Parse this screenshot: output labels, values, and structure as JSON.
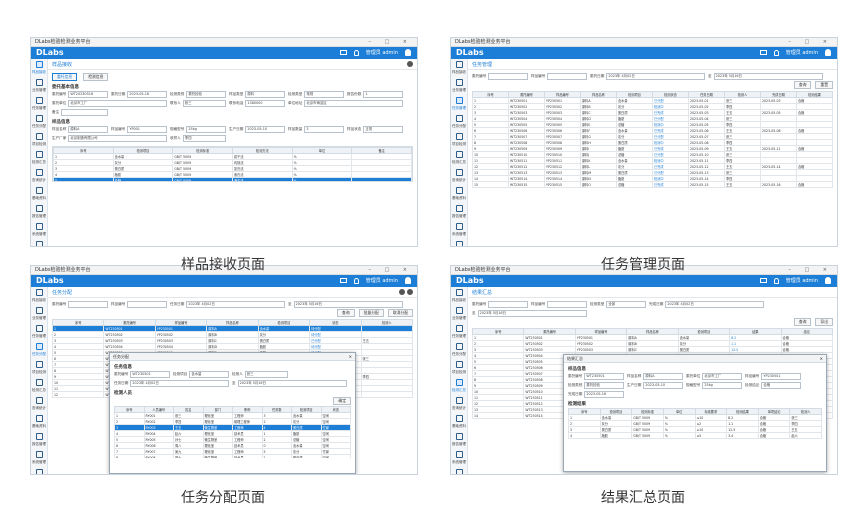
{
  "app": {
    "logo": "DLabs",
    "window_title": "DLabs检验检测业务平台",
    "user": "管理员 admin",
    "window_controls": "– □ ×"
  },
  "sidebar": [
    {
      "label": "样品接收"
    },
    {
      "label": "业务管理"
    },
    {
      "label": "任务管理"
    },
    {
      "label": "任务分配"
    },
    {
      "label": "项目检测"
    },
    {
      "label": "检测汇总"
    },
    {
      "label": "查询统计"
    },
    {
      "label": "基础资料"
    },
    {
      "label": "报告管理"
    },
    {
      "label": "系统管理"
    },
    {
      "label": "系统设置"
    }
  ],
  "captions": {
    "p1": "样品接收页面",
    "p2": "任务管理页面",
    "p3": "任务分配页面",
    "p4": "结果汇总页面"
  },
  "p1": {
    "title": "样品接收",
    "tabs": [
      "委托信息",
      "检测信息"
    ],
    "section1": "委托基本信息",
    "fields1": [
      {
        "label": "委托编号",
        "value": "WT20230516"
      },
      {
        "label": "委托日期",
        "value": "2023-05-16"
      },
      {
        "label": "检测类别",
        "value": "委托检验"
      },
      {
        "label": "样品类型",
        "value": "原料"
      },
      {
        "label": "检测类型",
        "value": "常规"
      },
      {
        "label": "报告份数",
        "value": "1"
      },
      {
        "label": "委托单位",
        "value": "北京市工厂"
      },
      {
        "label": "联系人",
        "value": "张三"
      },
      {
        "label": "联系电话",
        "value": "1380000"
      },
      {
        "label": "单位地址",
        "value": "北京市海淀区"
      },
      {
        "label": "备注",
        "value": ""
      }
    ],
    "section2": "样品信息",
    "fields2": [
      {
        "label": "样品名称",
        "value": "原料A"
      },
      {
        "label": "样品编号",
        "value": "YP001"
      },
      {
        "label": "规格型号",
        "value": "25kg"
      },
      {
        "label": "生产日期",
        "value": "2023-05-10"
      },
      {
        "label": "样品数量",
        "value": "3"
      },
      {
        "label": "样品状态",
        "value": "正常"
      },
      {
        "label": "生产厂家",
        "value": "北京制造有限公司"
      },
      {
        "label": "收样人",
        "value": "李四"
      }
    ],
    "table_headers": [
      "序号",
      "检测项目",
      "检测标准",
      "检测方法",
      "单位",
      "备注"
    ],
    "table_rows": [
      [
        "1",
        "含水量",
        "GB/T 5009",
        "烘干法",
        "%",
        ""
      ],
      [
        "2",
        "灰分",
        "GB/T 5009",
        "灼烧法",
        "%",
        ""
      ],
      [
        "3",
        "蛋白质",
        "GB/T 5009",
        "凯氏法",
        "%",
        ""
      ],
      [
        "4",
        "脂肪",
        "GB/T 5009",
        "索氏法",
        "%",
        ""
      ],
      [
        "5",
        "总糖",
        "GB/T 5009",
        "滴定法",
        "%",
        ""
      ]
    ]
  },
  "p2": {
    "title": "任务管理",
    "filters": [
      {
        "label": "委托编号",
        "value": ""
      },
      {
        "label": "样品编号",
        "value": ""
      },
      {
        "label": "委托日期",
        "value": "2023年 4月02日"
      },
      {
        "label": "至",
        "value": "2023年 5月16日"
      }
    ],
    "buttons": [
      "查询",
      "重置"
    ],
    "table_headers": [
      "序号",
      "委托编号",
      "样品编号",
      "样品名称",
      "检测项目",
      "检测状态",
      "任务日期",
      "检测人",
      "完成日期",
      "检测结果"
    ],
    "table_rows": [
      [
        "1",
        "WT230501",
        "YP230501",
        "原料A",
        "含水量",
        "已分配",
        "2023-05-01",
        "张三",
        "2023-05-03",
        "合格"
      ],
      [
        "2",
        "WT230502",
        "YP230502",
        "原料B",
        "灰分",
        "检测中",
        "2023-05-02",
        "李四",
        "",
        ""
      ],
      [
        "3",
        "WT230503",
        "YP230503",
        "原料C",
        "蛋白质",
        "已完成",
        "2023-05-03",
        "王五",
        "2023-05-05",
        "合格"
      ],
      [
        "4",
        "WT230504",
        "YP230504",
        "原料D",
        "脂肪",
        "已分配",
        "2023-05-04",
        "张三",
        "",
        ""
      ],
      [
        "5",
        "WT230505",
        "YP230505",
        "原料E",
        "总糖",
        "检测中",
        "2023-05-05",
        "李四",
        "",
        ""
      ],
      [
        "6",
        "WT230506",
        "YP230506",
        "原料F",
        "含水量",
        "已完成",
        "2023-05-06",
        "王五",
        "2023-05-08",
        "合格"
      ],
      [
        "7",
        "WT230507",
        "YP230507",
        "原料G",
        "灰分",
        "已分配",
        "2023-05-07",
        "张三",
        "",
        ""
      ],
      [
        "8",
        "WT230508",
        "YP230508",
        "原料H",
        "蛋白质",
        "检测中",
        "2023-05-08",
        "李四",
        "",
        ""
      ],
      [
        "9",
        "WT230509",
        "YP230509",
        "原料I",
        "脂肪",
        "已完成",
        "2023-05-09",
        "王五",
        "2023-05-11",
        "合格"
      ],
      [
        "10",
        "WT230510",
        "YP230510",
        "原料J",
        "总糖",
        "已分配",
        "2023-05-10",
        "张三",
        "",
        ""
      ],
      [
        "11",
        "WT230511",
        "YP230511",
        "原料K",
        "含水量",
        "检测中",
        "2023-05-11",
        "李四",
        "",
        ""
      ],
      [
        "12",
        "WT230512",
        "YP230512",
        "原料L",
        "灰分",
        "已完成",
        "2023-05-12",
        "王五",
        "2023-05-14",
        "合格"
      ],
      [
        "13",
        "WT230513",
        "YP230513",
        "原料M",
        "蛋白质",
        "已分配",
        "2023-05-13",
        "张三",
        "",
        ""
      ],
      [
        "14",
        "WT230514",
        "YP230514",
        "原料N",
        "脂肪",
        "检测中",
        "2023-05-14",
        "李四",
        "",
        ""
      ],
      [
        "15",
        "WT230515",
        "YP230515",
        "原料O",
        "总糖",
        "已完成",
        "2023-05-15",
        "王五",
        "2023-05-16",
        "合格"
      ]
    ]
  },
  "p3": {
    "title": "任务分配",
    "filters": [
      {
        "label": "委托编号",
        "value": ""
      },
      {
        "label": "样品编号",
        "value": ""
      },
      {
        "label": "任务日期",
        "value": "2023年 4月02日"
      },
      {
        "label": "至",
        "value": "2023年 5月16日"
      }
    ],
    "buttons": [
      "查询",
      "批量分配",
      "取消分配"
    ],
    "table_headers": [
      "序号",
      "委托编号",
      "样品编号",
      "样品名称",
      "检测项目",
      "状态",
      "检测人"
    ],
    "table_rows": [
      [
        "1",
        "WT230501",
        "YP230501",
        "原料A",
        "含水量",
        "待分配",
        ""
      ],
      [
        "2",
        "WT230502",
        "YP230502",
        "原料B",
        "灰分",
        "待分配",
        ""
      ],
      [
        "3",
        "WT230503",
        "YP230503",
        "原料C",
        "蛋白质",
        "已分配",
        "王五"
      ],
      [
        "4",
        "WT230504",
        "YP230504",
        "原料D",
        "脂肪",
        "待分配",
        ""
      ],
      [
        "5",
        "WT230505",
        "YP230505",
        "原料E",
        "总糖",
        "待分配",
        ""
      ],
      [
        "6",
        "WT230506",
        "YP230506",
        "原料F",
        "含水量",
        "已分配",
        "张三"
      ],
      [
        "7",
        "WT230507",
        "YP230507",
        "原料G",
        "灰分",
        "待分配",
        ""
      ],
      [
        "8",
        "WT230508",
        "YP230508",
        "原料H",
        "蛋白质",
        "待分配",
        ""
      ],
      [
        "9",
        "WT230509",
        "YP230509",
        "原料I",
        "脂肪",
        "已分配",
        "李四"
      ],
      [
        "10",
        "WT230510",
        "YP230510",
        "原料J",
        "总糖",
        "待分配",
        ""
      ],
      [
        "11",
        "WT230511",
        "YP230511",
        "原料K",
        "含水量",
        "待分配",
        ""
      ],
      [
        "12",
        "WT230512",
        "YP230512",
        "原料L",
        "灰分",
        "待分配",
        ""
      ]
    ],
    "modal": {
      "title": "任务分配",
      "section1": "任务信息",
      "fields": [
        {
          "label": "委托编号",
          "value": "WT230501"
        },
        {
          "label": "检测项目",
          "value": "含水量"
        },
        {
          "label": "检测人",
          "value": "张三"
        },
        {
          "label": "任务日期",
          "value": "2023年 4月02日"
        },
        {
          "label": "至",
          "value": "2023年 5月16日"
        }
      ],
      "section2": "检测人员",
      "confirm": "确定",
      "table_headers": [
        "序号",
        "人员编号",
        "姓名",
        "部门",
        "职称",
        "任务数",
        "检测项目",
        "状态"
      ],
      "table_rows": [
        [
          "1",
          "RY001",
          "张三",
          "理化室",
          "工程师",
          "3",
          "含水量",
          "空闲"
        ],
        [
          "2",
          "RY002",
          "李四",
          "理化室",
          "助理工程师",
          "2",
          "灰分",
          "空闲"
        ],
        [
          "3",
          "RY003",
          "王五",
          "微生物室",
          "工程师",
          "4",
          "蛋白质",
          "忙碌"
        ],
        [
          "4",
          "RY004",
          "赵六",
          "理化室",
          "技术员",
          "1",
          "脂肪",
          "空闲"
        ],
        [
          "5",
          "RY005",
          "孙七",
          "微生物室",
          "工程师",
          "2",
          "总糖",
          "空闲"
        ],
        [
          "6",
          "RY006",
          "周八",
          "理化室",
          "技术员",
          "0",
          "含水量",
          "空闲"
        ],
        [
          "7",
          "RY007",
          "吴九",
          "理化室",
          "工程师",
          "5",
          "灰分",
          "忙碌"
        ],
        [
          "8",
          "RY008",
          "郑十",
          "微生物室",
          "技术员",
          "1",
          "蛋白质",
          "空闲"
        ]
      ]
    }
  },
  "p4": {
    "title": "结果汇总",
    "filters": [
      {
        "label": "委托编号",
        "value": ""
      },
      {
        "label": "样品编号",
        "value": ""
      },
      {
        "label": "检测类型",
        "value": "全部"
      },
      {
        "label": "完成日期",
        "value": "2023年 4月02日"
      },
      {
        "label": "至",
        "value": "2023年 5月16日"
      }
    ],
    "buttons": [
      "查询",
      "导出"
    ],
    "table_headers": [
      "序号",
      "委托编号",
      "样品编号",
      "样品名称",
      "检测项目",
      "结果",
      "结论"
    ],
    "table_rows": [
      [
        "1",
        "WT230501",
        "YP230501",
        "原料A",
        "含水量",
        "8.2",
        "合格"
      ],
      [
        "2",
        "WT230502",
        "YP230502",
        "原料B",
        "灰分",
        "1.1",
        "合格"
      ],
      [
        "3",
        "WT230503",
        "YP230503",
        "原料C",
        "蛋白质",
        "12.5",
        "合格"
      ],
      [
        "4",
        "WT230504",
        "YP230504",
        "原料D",
        "脂肪",
        "3.4",
        "合格"
      ],
      [
        "5",
        "WT230505",
        "YP230505",
        "原料E",
        "总糖",
        "5.6",
        "合格"
      ],
      [
        "6",
        "WT230506",
        "YP230506",
        "原料F",
        "含水量",
        "9.1",
        "合格"
      ],
      [
        "7",
        "WT230507",
        "YP230507",
        "原料G",
        "灰分",
        "1.3",
        "合格"
      ],
      [
        "8",
        "WT230508",
        "YP230508",
        "原料H",
        "蛋白质",
        "11.8",
        "合格"
      ],
      [
        "9",
        "WT230509",
        "YP230509",
        "原料I",
        "脂肪",
        "3.2",
        "合格"
      ],
      [
        "10",
        "WT230510",
        "YP230510",
        "原料J",
        "总糖",
        "5.1",
        "合格"
      ],
      [
        "11",
        "WT230511",
        "YP230511",
        "原料K",
        "含水量",
        "8.7",
        "合格"
      ],
      [
        "12",
        "WT230512",
        "YP230512",
        "原料L",
        "灰分",
        "1.0",
        "合格"
      ],
      [
        "13",
        "WT230513",
        "YP230513",
        "原料M",
        "蛋白质",
        "12.1",
        "合格"
      ],
      [
        "14",
        "WT230514",
        "YP230514",
        "原料N",
        "脂肪",
        "3.6",
        "合格"
      ]
    ],
    "modal": {
      "title": "结果汇总",
      "section1": "样品信息",
      "fields": [
        {
          "label": "委托编号",
          "value": "WT230501"
        },
        {
          "label": "样品名称",
          "value": "原料A"
        },
        {
          "label": "委托单位",
          "value": "北京市工厂"
        },
        {
          "label": "样品编号",
          "value": "YP230501"
        },
        {
          "label": "检测类别",
          "value": "委托检验"
        },
        {
          "label": "生产日期",
          "value": "2023-05-10"
        },
        {
          "label": "规格型号",
          "value": "25kg"
        },
        {
          "label": "检测结论",
          "value": "合格"
        },
        {
          "label": "完成日期",
          "value": "2023-05-16"
        }
      ],
      "section2": "检测结果",
      "table_headers": [
        "序号",
        "检测项目",
        "检测标准",
        "单位",
        "标准要求",
        "检测结果",
        "单项结论",
        "检测人"
      ],
      "table_rows": [
        [
          "1",
          "含水量",
          "GB/T 5009",
          "%",
          "≤10",
          "8.2",
          "合格",
          "张三"
        ],
        [
          "2",
          "灰分",
          "GB/T 5009",
          "%",
          "≤2",
          "1.1",
          "合格",
          "李四"
        ],
        [
          "3",
          "蛋白质",
          "GB/T 5009",
          "%",
          "≥10",
          "12.5",
          "合格",
          "王五"
        ],
        [
          "4",
          "脂肪",
          "GB/T 5009",
          "%",
          "≤5",
          "3.4",
          "合格",
          "赵六"
        ]
      ]
    }
  }
}
